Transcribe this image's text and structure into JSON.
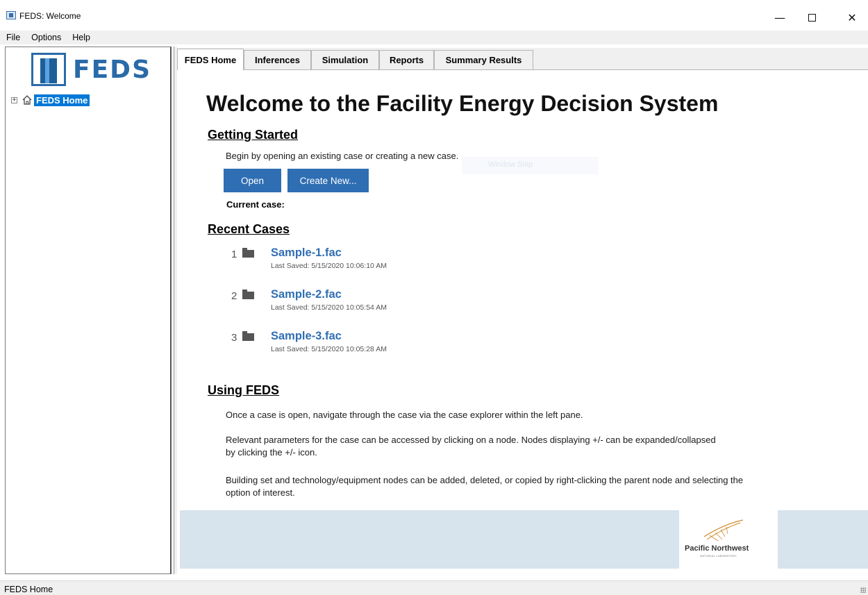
{
  "window": {
    "title": "FEDS: Welcome",
    "controls": {
      "minimize": "—",
      "close": "✕"
    }
  },
  "menu": [
    "File",
    "Options",
    "Help"
  ],
  "logo": {
    "text": "FEDS"
  },
  "tree": {
    "expander": "+",
    "root_label": "FEDS Home"
  },
  "tabs": [
    "FEDS Home",
    "Inferences",
    "Simulation",
    "Reports",
    "Summary Results"
  ],
  "active_tab": "FEDS Home",
  "main": {
    "heading": "Welcome to the Facility Energy Decision System",
    "getting_started": {
      "title": "Getting Started",
      "text": "Begin by opening an existing case or creating a new case.",
      "open_label": "Open",
      "create_label": "Create New...",
      "current_case_label": "Current case:",
      "ghost_text": "Window Snip"
    },
    "recent": {
      "title": "Recent Cases",
      "items": [
        {
          "num": "1",
          "name": "Sample-1.fac",
          "saved": "Last Saved:  5/15/2020 10:06:10 AM"
        },
        {
          "num": "2",
          "name": "Sample-2.fac",
          "saved": "Last Saved:  5/15/2020 10:05:54 AM"
        },
        {
          "num": "3",
          "name": "Sample-3.fac",
          "saved": "Last Saved:  5/15/2020 10:05:28 AM"
        }
      ]
    },
    "using": {
      "title": "Using FEDS",
      "p1": "Once a case is open, navigate through the case via the case explorer within the left pane.",
      "p2": "Relevant parameters for the case can be accessed by clicking on a node. Nodes displaying +/- can be expanded/collapsed by clicking the +/- icon.",
      "p3": "Building set and technology/equipment nodes can be added, deleted, or copied by right-clicking the parent node and selecting the option of interest."
    },
    "footer": {
      "org": "Pacific Northwest",
      "org_sub": "NATIONAL LABORATORY"
    }
  },
  "status": {
    "text": "FEDS Home"
  },
  "colors": {
    "accent": "#2f6eb3",
    "selection": "#0078d7",
    "footer_band": "#d7e3ed"
  }
}
